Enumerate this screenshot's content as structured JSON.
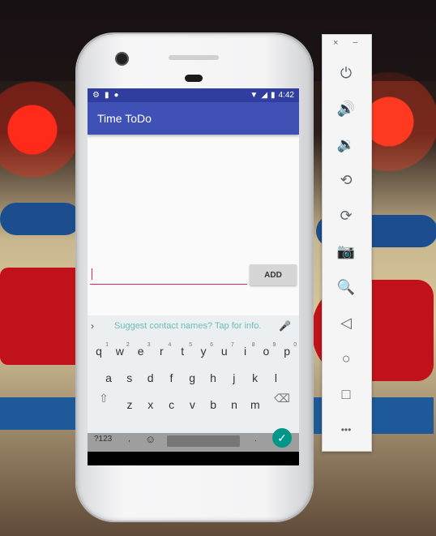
{
  "emulator_panel": {
    "close_label": "×",
    "minimize_label": "−",
    "buttons": [
      {
        "name": "power-icon",
        "glyph": "⏻"
      },
      {
        "name": "volume-up-icon",
        "glyph": "🔊"
      },
      {
        "name": "volume-down-icon",
        "glyph": "🔉"
      },
      {
        "name": "rotate-left-icon",
        "glyph": "⟲"
      },
      {
        "name": "rotate-right-icon",
        "glyph": "⟳"
      },
      {
        "name": "camera-icon",
        "glyph": "📷"
      },
      {
        "name": "zoom-icon",
        "glyph": "🔍"
      },
      {
        "name": "back-icon",
        "glyph": "◁"
      },
      {
        "name": "home-icon",
        "glyph": "○"
      },
      {
        "name": "overview-icon",
        "glyph": "□"
      },
      {
        "name": "more-icon",
        "glyph": "•••"
      }
    ]
  },
  "status_bar": {
    "time": "4:42"
  },
  "app": {
    "title": "Time ToDo",
    "add_button": "ADD",
    "input_value": ""
  },
  "keyboard": {
    "suggestion": "Suggest contact names? Tap for info.",
    "row1": [
      "q",
      "w",
      "e",
      "r",
      "t",
      "y",
      "u",
      "i",
      "o",
      "p"
    ],
    "row1_hints": [
      "1",
      "2",
      "3",
      "4",
      "5",
      "6",
      "7",
      "8",
      "9",
      "0"
    ],
    "row2": [
      "a",
      "s",
      "d",
      "f",
      "g",
      "h",
      "j",
      "k",
      "l"
    ],
    "row3": [
      "z",
      "x",
      "c",
      "v",
      "b",
      "n",
      "m"
    ],
    "symbols_label": "?123",
    "comma_label": ",",
    "period_label": ".",
    "emoji_label": "☺"
  },
  "colors": {
    "primary": "#3f51b5",
    "primary_dark": "#303f9f",
    "accent": "#e91e63",
    "enter_key": "#009688"
  }
}
